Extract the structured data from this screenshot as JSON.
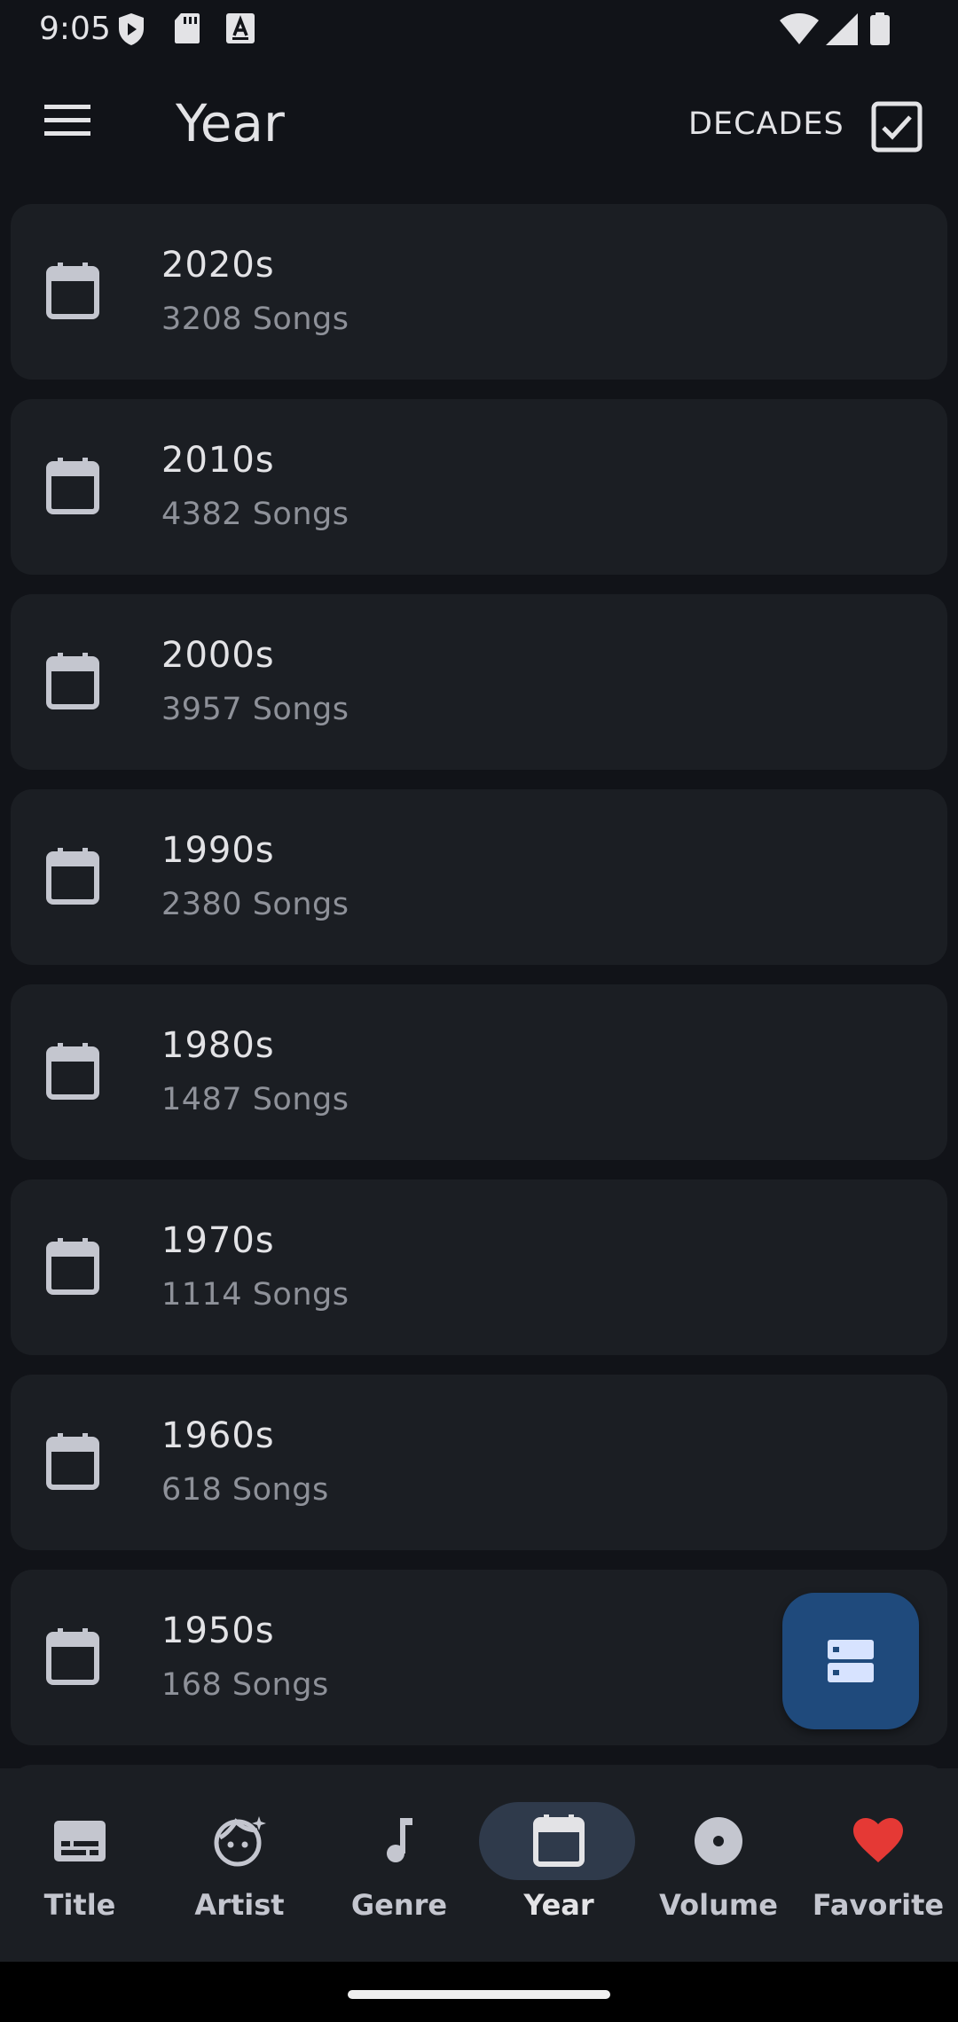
{
  "status_bar": {
    "time": "9:05"
  },
  "app_bar": {
    "title": "Year",
    "decades_label": "DECADES",
    "decades_checked": true
  },
  "decades": [
    {
      "label": "2020s",
      "count": "3208 Songs"
    },
    {
      "label": "2010s",
      "count": "4382 Songs"
    },
    {
      "label": "2000s",
      "count": "3957 Songs"
    },
    {
      "label": "1990s",
      "count": "2380 Songs"
    },
    {
      "label": "1980s",
      "count": "1487 Songs"
    },
    {
      "label": "1970s",
      "count": "1114 Songs"
    },
    {
      "label": "1960s",
      "count": "618 Songs"
    },
    {
      "label": "1950s",
      "count": "168 Songs"
    }
  ],
  "fab": {
    "icon": "storage-icon"
  },
  "bottom_nav": {
    "items": [
      {
        "label": "Title",
        "icon": "subtitles-icon"
      },
      {
        "label": "Artist",
        "icon": "face-icon"
      },
      {
        "label": "Genre",
        "icon": "music-note-icon"
      },
      {
        "label": "Year",
        "icon": "calendar-icon",
        "active": true
      },
      {
        "label": "Volume",
        "icon": "album-icon"
      },
      {
        "label": "Favorite",
        "icon": "heart-icon"
      }
    ]
  },
  "colors": {
    "background": "#111318",
    "card": "#1b1e23",
    "fab": "#1f4a7c",
    "active_pill": "#2f3a4b",
    "favorite_heart": "#e53935"
  }
}
